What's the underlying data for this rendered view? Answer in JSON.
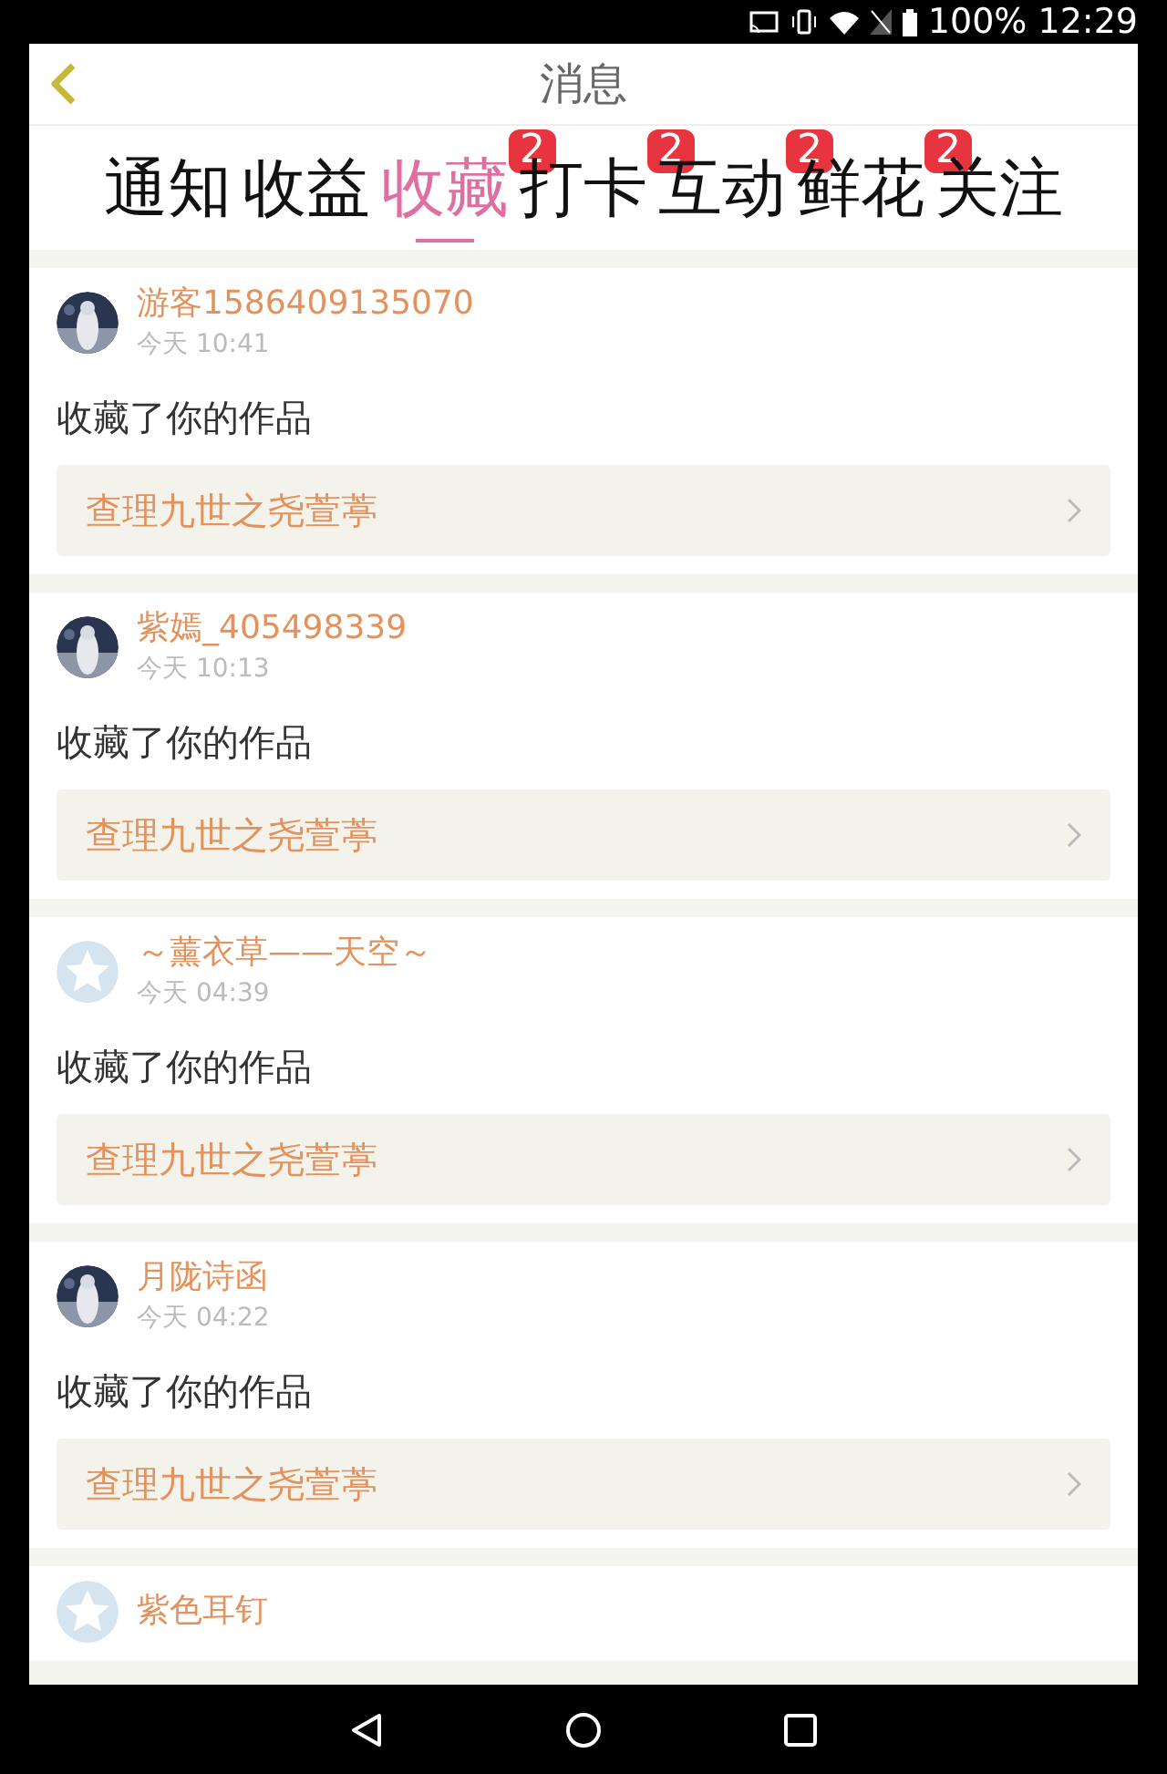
{
  "status_bar": {
    "battery": "100%",
    "time": "12:29"
  },
  "header": {
    "title": "消息"
  },
  "tabs": [
    {
      "label": "通知",
      "selected": false
    },
    {
      "label": "收益",
      "selected": false
    },
    {
      "label": "收藏",
      "selected": true,
      "badge": "2"
    },
    {
      "label": "打卡",
      "selected": false,
      "badge": "2"
    },
    {
      "label": "互动",
      "selected": false,
      "badge": "2"
    },
    {
      "label": "鲜花",
      "selected": false,
      "badge": "2"
    },
    {
      "label": "关注",
      "selected": false
    }
  ],
  "messages": [
    {
      "name": "游客1586409135070",
      "time": "今天 10:41",
      "text": "收藏了你的作品",
      "work": "查理九世之尧萱葶"
    },
    {
      "name": "紫嫣_405498339",
      "time": "今天 10:13",
      "text": "收藏了你的作品",
      "work": "查理九世之尧萱葶"
    },
    {
      "avatar": {
        "kind": "default"
      },
      "name": "～薰衣草——天空～",
      "time": "今天 04:39",
      "text": "收藏了你的作品",
      "work": "查理九世之尧萱葶"
    },
    {
      "name": "月陇诗函",
      "time": "今天 04:22",
      "text": "收藏了你的作品",
      "work": "查理九世之尧萱葶"
    },
    {
      "avatar": {
        "kind": "default"
      },
      "name": "紫色耳钉"
    }
  ]
}
